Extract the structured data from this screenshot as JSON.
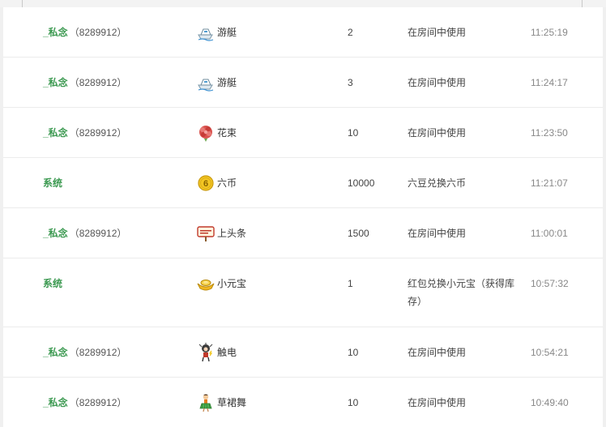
{
  "records": [
    {
      "sender": "_私念",
      "sender_id": "（8289912）",
      "gift": "游艇",
      "icon": "yacht-icon",
      "qty": "2",
      "desc": "在房间中使用",
      "time": "11:25:19"
    },
    {
      "sender": "_私念",
      "sender_id": "（8289912）",
      "gift": "游艇",
      "icon": "yacht-icon",
      "qty": "3",
      "desc": "在房间中使用",
      "time": "11:24:17"
    },
    {
      "sender": "_私念",
      "sender_id": "（8289912）",
      "gift": "花束",
      "icon": "bouquet-icon",
      "qty": "10",
      "desc": "在房间中使用",
      "time": "11:23:50"
    },
    {
      "sender": "系统",
      "sender_id": "",
      "gift": "六币",
      "icon": "six-coin-icon",
      "qty": "10000",
      "desc": "六豆兑换六币",
      "time": "11:21:07"
    },
    {
      "sender": "_私念",
      "sender_id": "（8289912）",
      "gift": "上头条",
      "icon": "headline-sign-icon",
      "qty": "1500",
      "desc": "在房间中使用",
      "time": "11:00:01"
    },
    {
      "sender": "系统",
      "sender_id": "",
      "gift": "小元宝",
      "icon": "gold-ingot-icon",
      "qty": "1",
      "desc": "红包兑换小元宝（获得库存）",
      "time": "10:57:32"
    },
    {
      "sender": "_私念",
      "sender_id": "（8289912）",
      "gift": "触电",
      "icon": "electric-shock-icon",
      "qty": "10",
      "desc": "在房间中使用",
      "time": "10:54:21"
    },
    {
      "sender": "_私念",
      "sender_id": "（8289912）",
      "gift": "草裙舞",
      "icon": "hula-dancer-icon",
      "qty": "10",
      "desc": "在房间中使用",
      "time": "10:49:40"
    }
  ],
  "colors": {
    "sender": "#3d9a52",
    "text": "#444444",
    "time": "#888888"
  }
}
